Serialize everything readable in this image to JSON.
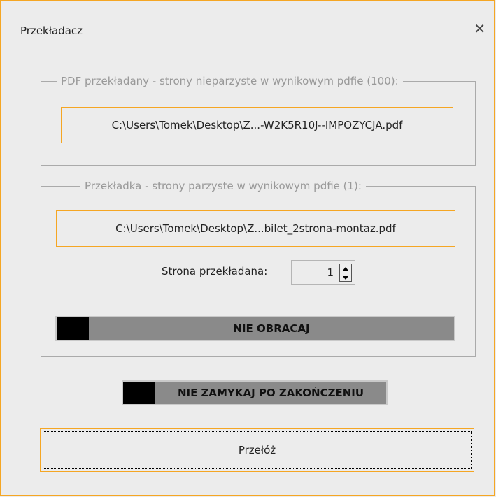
{
  "window": {
    "title": "Przekładacz",
    "close_glyph": "✕",
    "accent_color": "#f5a623"
  },
  "group1": {
    "legend": "PDF przekładany - strony nieparzyste w wynikowym pdfie (100):",
    "file_path": "C:\\Users\\Tomek\\Desktop\\Z...-W2K5R10J--IMPOZYCJA.pdf"
  },
  "group2": {
    "legend": "Przekładka - strony parzyste w wynikowym pdfie (1):",
    "file_path": "C:\\Users\\Tomek\\Desktop\\Z...bilet_2strona-montaz.pdf",
    "page_label": "Strona przekładana:",
    "page_value": "1",
    "rotate_toggle_label": "NIE OBRACAJ"
  },
  "close_toggle_label": "NIE ZAMYKAJ PO ZAKOŃCZENIU",
  "action_button_label": "Przełóż"
}
